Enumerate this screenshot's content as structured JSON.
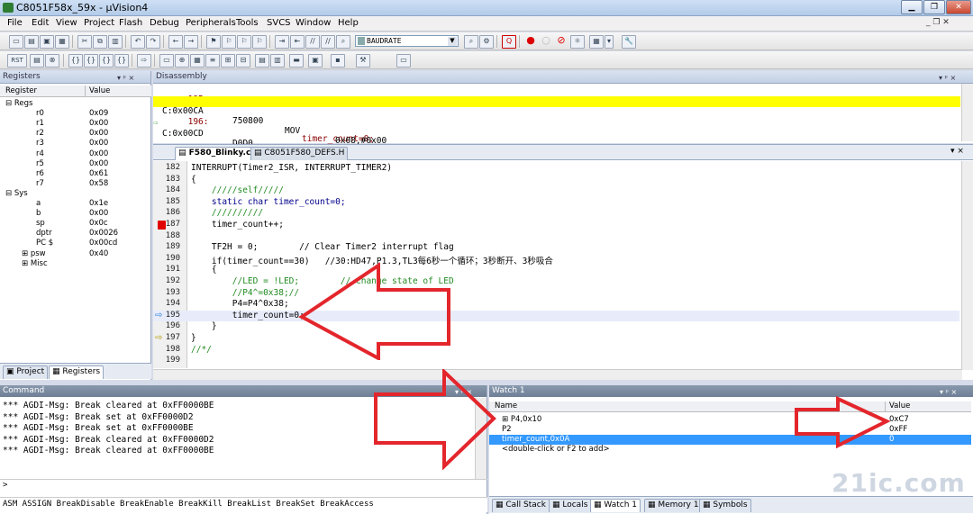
{
  "window": {
    "title": "C8051F58x_59x - µVision4"
  },
  "menu": [
    "File",
    "Edit",
    "View",
    "Project",
    "Flash",
    "Debug",
    "Peripherals",
    "Tools",
    "SVCS",
    "Window",
    "Help"
  ],
  "toolbar": {
    "target_combo": "BAUDRATE",
    "rst_label": "RST"
  },
  "registers": {
    "title": "Registers",
    "col_register": "Register",
    "col_value": "Value",
    "groups": [
      {
        "name": "Regs",
        "items": [
          {
            "name": "r0",
            "value": "0x09"
          },
          {
            "name": "r1",
            "value": "0x00"
          },
          {
            "name": "r2",
            "value": "0x00"
          },
          {
            "name": "r3",
            "value": "0x00"
          },
          {
            "name": "r4",
            "value": "0x00"
          },
          {
            "name": "r5",
            "value": "0x00"
          },
          {
            "name": "r6",
            "value": "0x61"
          },
          {
            "name": "r7",
            "value": "0x58"
          }
        ]
      },
      {
        "name": "Sys",
        "items": [
          {
            "name": "a",
            "value": "0x1e"
          },
          {
            "name": "b",
            "value": "0x00"
          },
          {
            "name": "sp",
            "value": "0x0c"
          },
          {
            "name": "dptr",
            "value": "0x0026"
          },
          {
            "name": "PC  $",
            "value": "0x00cd"
          },
          {
            "name": "psw",
            "value": "0x40"
          },
          {
            "name": "Misc",
            "value": ""
          }
        ]
      }
    ],
    "tabs": [
      "Project",
      "Registers"
    ]
  },
  "disassembly": {
    "title": "Disassembly",
    "lines": [
      {
        "addr": "     195:",
        "bytes": "",
        "op": "",
        "args": "",
        "src": "timer_count=0;"
      },
      {
        "addr": "C:0x00CA",
        "bytes": "750800",
        "op": "MOV",
        "args": "0x08,#0x00",
        "src": ""
      },
      {
        "addr": "     196:",
        "bytes": "",
        "op": "",
        "args": "",
        "src": "}"
      },
      {
        "addr": "C:0x00CD",
        "bytes": "D0D0",
        "op": "POP",
        "args": "PSW(0xD0)",
        "src": ""
      }
    ]
  },
  "editor": {
    "tabs": [
      "F580_Blinky.c",
      "C8051F580_DEFS.H"
    ],
    "lines": [
      {
        "n": "182",
        "t": "INTERRUPT(Timer2_ISR, INTERRUPT_TIMER2)",
        "c": ""
      },
      {
        "n": "183",
        "t": "{",
        "c": ""
      },
      {
        "n": "184",
        "t": "    /////self/////",
        "c": "cm"
      },
      {
        "n": "185",
        "t": "    static char timer_count=0;",
        "c": "kw"
      },
      {
        "n": "186",
        "t": "    //////////",
        "c": "cm"
      },
      {
        "n": "187",
        "t": "    timer_count++;",
        "c": ""
      },
      {
        "n": "188",
        "t": "",
        "c": ""
      },
      {
        "n": "189",
        "t": "    TF2H = 0;        // Clear Timer2 interrupt flag",
        "c": ""
      },
      {
        "n": "190",
        "t": "    if(timer_count==30)   //30:HD47,P1.3,TL3每6秒一个循环；3秒断开、3秒吸合",
        "c": ""
      },
      {
        "n": "191",
        "t": "    {",
        "c": ""
      },
      {
        "n": "192",
        "t": "        //LED = !LED;        // Change state of LED",
        "c": "cm"
      },
      {
        "n": "193",
        "t": "        //P4^=0x38;//",
        "c": "cm"
      },
      {
        "n": "194",
        "t": "        P4=P4^0x38;",
        "c": ""
      },
      {
        "n": "195",
        "t": "        timer_count=0;",
        "c": ""
      },
      {
        "n": "196",
        "t": "    }",
        "c": ""
      },
      {
        "n": "197",
        "t": "}",
        "c": ""
      },
      {
        "n": "198",
        "t": "//*/",
        "c": "cm"
      },
      {
        "n": "199",
        "t": "",
        "c": ""
      }
    ]
  },
  "command": {
    "title": "Command",
    "lines": [
      "*** AGDI-Msg: Break cleared at 0xFF0000BE",
      "*** AGDI-Msg: Break set at 0xFF0000D2",
      "*** AGDI-Msg: Break set at 0xFF0000BE",
      "*** AGDI-Msg: Break cleared at 0xFF0000D2",
      "*** AGDI-Msg: Break cleared at 0xFF0000BE"
    ],
    "prompt": ">",
    "status": "ASM ASSIGN BreakDisable BreakEnable BreakKill BreakList BreakSet BreakAccess"
  },
  "watch": {
    "title": "Watch 1",
    "col_name": "Name",
    "col_value": "Value",
    "rows": [
      {
        "name": "P4,0x10",
        "value": "0xC7"
      },
      {
        "name": "P2",
        "value": "0xFF"
      },
      {
        "name": "timer_count,0x0A",
        "value": "0"
      },
      {
        "name": "<double-click or F2 to add>",
        "value": ""
      }
    ],
    "tabs": [
      "Call Stack",
      "Locals",
      "Watch 1",
      "Memory 1",
      "Symbols"
    ]
  },
  "watermark": {
    "text": "21ic.com"
  },
  "colors": {
    "highlight": "#ffff00",
    "selection": "#3399ff",
    "arrow": "#e3262c"
  }
}
